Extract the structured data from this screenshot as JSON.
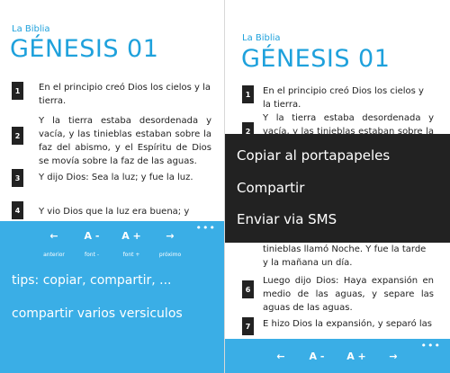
{
  "left": {
    "app_title": "La Biblia",
    "chapter_title": "GÉNESIS 01",
    "verses": [
      {
        "num": "1",
        "text": "En el principio creó Dios los cielos y la tierra."
      },
      {
        "num": "2",
        "text": "Y la tierra estaba desordenada y vacía, y las tinieblas estaban sobre la faz del abismo, y el Espíritu de Dios se movía sobre la faz de las aguas."
      },
      {
        "num": "3",
        "text": "Y dijo Dios: Sea la luz; y fue la luz."
      },
      {
        "num": "4",
        "text": "Y vio Dios que la luz era buena; y"
      }
    ],
    "appbar": {
      "more": "•••",
      "buttons": [
        {
          "glyph": "←",
          "label": "anterior"
        },
        {
          "glyph": "A -",
          "label": "font -"
        },
        {
          "glyph": "A +",
          "label": "font +"
        },
        {
          "glyph": "→",
          "label": "próximo"
        }
      ],
      "menu_items": [
        "tips: copiar, compartir, ...",
        "compartir varios versiculos"
      ]
    }
  },
  "right": {
    "app_title": "La Biblia",
    "chapter_title": "GÉNESIS 01",
    "verses": [
      {
        "num": "1",
        "text": "En el principio creó Dios los cielos y la tierra."
      },
      {
        "num": "2",
        "text": "Y la tierra estaba desordenada y vacía, y las tinieblas estaban sobre la faz del abismo, y el Espíritu de Dios se movía"
      },
      {
        "num": "",
        "text": "tinieblas llamó Noche. Y fue la tarde y la mañana un día."
      },
      {
        "num": "6",
        "text": "Luego dijo Dios: Haya expansión en medio de las aguas, y separe las aguas de las aguas."
      },
      {
        "num": "7",
        "text": "E hizo Dios la expansión, y separó las"
      }
    ],
    "context_menu": [
      "Copiar al portapapeles",
      "Compartir",
      "Enviar via SMS"
    ],
    "appbar": {
      "more": "•••",
      "buttons": [
        {
          "glyph": "←"
        },
        {
          "glyph": "A -"
        },
        {
          "glyph": "A +"
        },
        {
          "glyph": "→"
        }
      ]
    }
  },
  "colors": {
    "accent": "#3aaee6",
    "title": "#1ea1dc",
    "menu_bg": "#222222"
  }
}
